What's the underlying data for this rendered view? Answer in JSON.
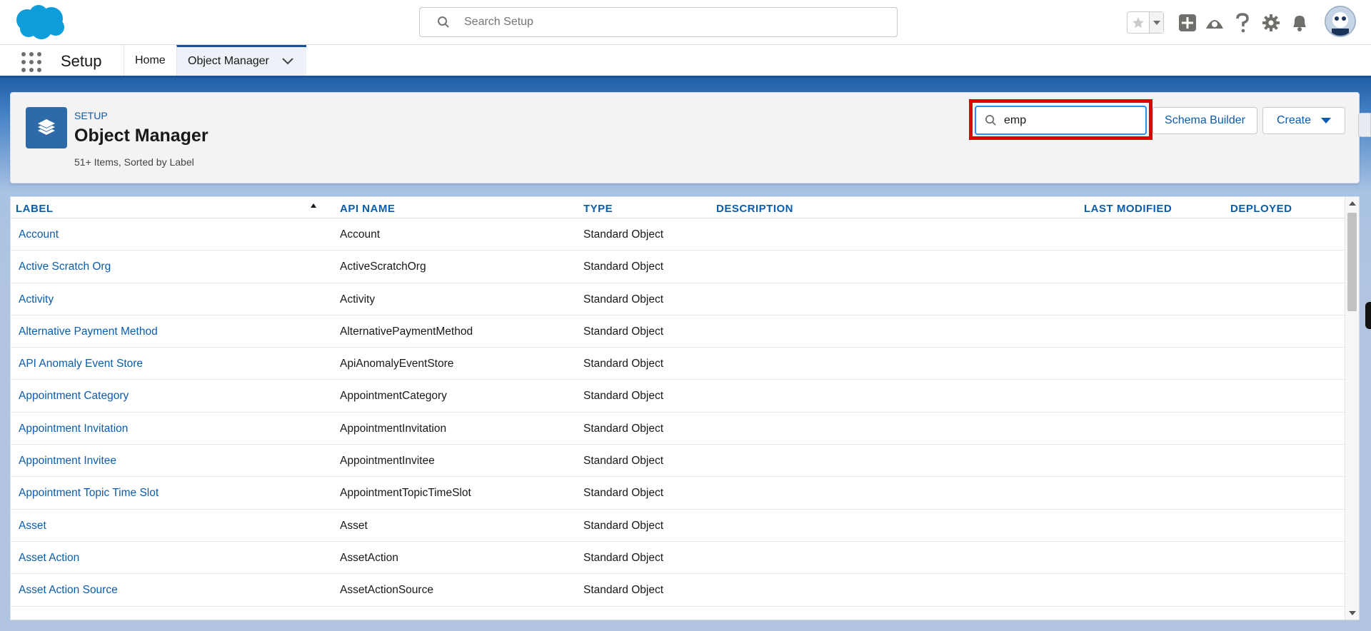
{
  "global_header": {
    "search_placeholder": "Search Setup",
    "icons": [
      "salesforce-cloud-logo",
      "search-icon",
      "favorites-star-icon",
      "favorites-dropdown-icon",
      "add-icon",
      "trailhead-icon",
      "help-icon",
      "setup-gear-icon",
      "notifications-bell-icon",
      "user-avatar"
    ]
  },
  "nav": {
    "app_name": "Setup",
    "tabs": [
      {
        "label": "Home"
      },
      {
        "label": "Object Manager",
        "active": true
      }
    ]
  },
  "page_header": {
    "breadcrumb": "SETUP",
    "title": "Object Manager",
    "meta": "51+ Items, Sorted by Label",
    "quick_find_value": "emp",
    "schema_builder_label": "Schema Builder",
    "create_label": "Create"
  },
  "table": {
    "columns": [
      "LABEL",
      "API NAME",
      "TYPE",
      "DESCRIPTION",
      "LAST MODIFIED",
      "DEPLOYED"
    ],
    "sort": {
      "column": "LABEL",
      "direction": "ascending"
    },
    "rows": [
      {
        "label": "Account",
        "api": "Account",
        "type": "Standard Object"
      },
      {
        "label": "Active Scratch Org",
        "api": "ActiveScratchOrg",
        "type": "Standard Object"
      },
      {
        "label": "Activity",
        "api": "Activity",
        "type": "Standard Object"
      },
      {
        "label": "Alternative Payment Method",
        "api": "AlternativePaymentMethod",
        "type": "Standard Object"
      },
      {
        "label": "API Anomaly Event Store",
        "api": "ApiAnomalyEventStore",
        "type": "Standard Object"
      },
      {
        "label": "Appointment Category",
        "api": "AppointmentCategory",
        "type": "Standard Object"
      },
      {
        "label": "Appointment Invitation",
        "api": "AppointmentInvitation",
        "type": "Standard Object"
      },
      {
        "label": "Appointment Invitee",
        "api": "AppointmentInvitee",
        "type": "Standard Object"
      },
      {
        "label": "Appointment Topic Time Slot",
        "api": "AppointmentTopicTimeSlot",
        "type": "Standard Object"
      },
      {
        "label": "Asset",
        "api": "Asset",
        "type": "Standard Object"
      },
      {
        "label": "Asset Action",
        "api": "AssetAction",
        "type": "Standard Object"
      },
      {
        "label": "Asset Action Source",
        "api": "AssetActionSource",
        "type": "Standard Object"
      },
      {
        "label": "",
        "api": "",
        "type": ""
      }
    ]
  },
  "colors": {
    "brand_blue": "#0b5cab",
    "highlight_red": "#e00000",
    "focus_blue": "#1b96ff",
    "object_icon_bg": "#2e6aa8"
  }
}
